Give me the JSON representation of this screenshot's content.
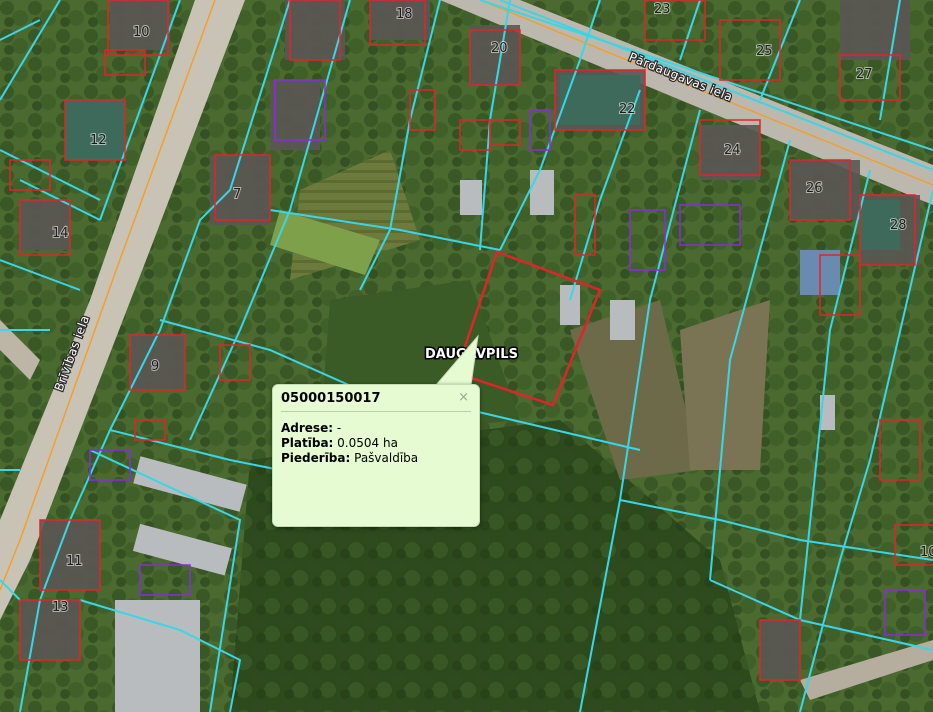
{
  "map": {
    "city_label": "DAUGAVPILS",
    "streets": [
      {
        "name": "Pārdaugavas iela"
      },
      {
        "name": "Brīvības iela"
      }
    ],
    "house_numbers": [
      "10",
      "18",
      "23",
      "20",
      "25",
      "27",
      "12",
      "22",
      "24",
      "7",
      "26",
      "14",
      "28",
      "9",
      "11",
      "13",
      "10"
    ],
    "colors": {
      "parcel": "#39d6e6",
      "building": "#e0242a",
      "other": "#8a2be2",
      "selected": "#e0242a",
      "road_center": "#f0a030"
    }
  },
  "popup": {
    "title": "05000150017",
    "close": "×",
    "rows": [
      {
        "label": "Adrese:",
        "value": "-"
      },
      {
        "label": "Platība:",
        "value": "0.0504 ha"
      },
      {
        "label": "Piederība:",
        "value": "Pašvaldība"
      }
    ]
  }
}
